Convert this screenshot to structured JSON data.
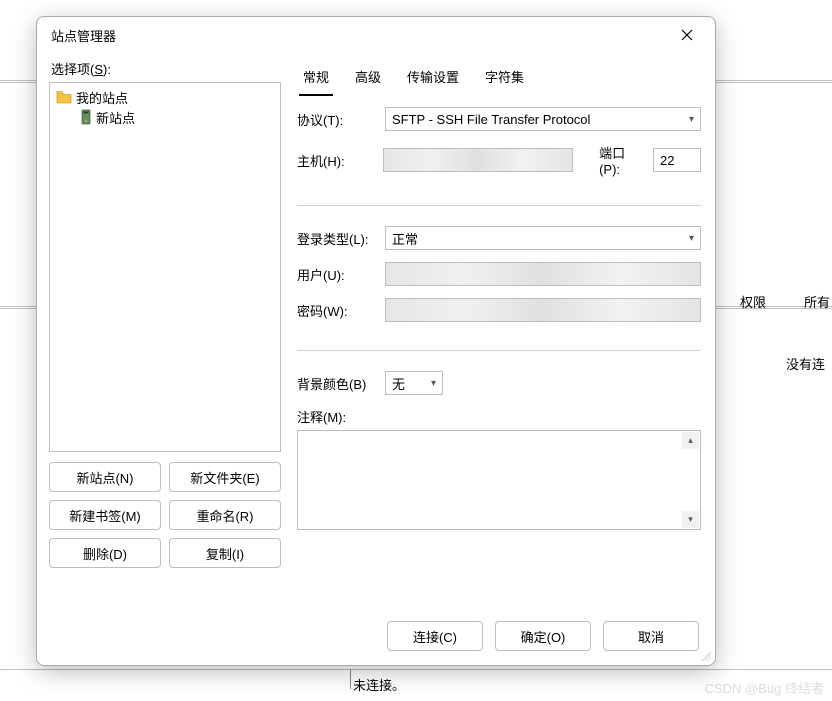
{
  "background": {
    "col_permissions": "权限",
    "col_owner_prefix": "所有",
    "no_connection_msg_prefix": "没有连",
    "status_text": "未连接。"
  },
  "dialog": {
    "title": "站点管理器",
    "select_label_pre": "选择项(",
    "select_label_key": "S",
    "select_label_post": "):",
    "tree": {
      "root": "我的站点",
      "child": "新站点"
    },
    "buttons": {
      "new_site": "新站点(N)",
      "new_folder": "新文件夹(E)",
      "new_bookmark": "新建书签(M)",
      "rename": "重命名(R)",
      "delete": "删除(D)",
      "copy": "复制(I)"
    },
    "tabs": {
      "general": "常规",
      "advanced": "高级",
      "transfer": "传输设置",
      "charset": "字符集"
    },
    "fields": {
      "protocol_label": "协议(T):",
      "protocol_value": "SFTP - SSH File Transfer Protocol",
      "host_label": "主机(H):",
      "host_value": "",
      "port_label": "端口(P):",
      "port_value": "22",
      "logon_type_label": "登录类型(L):",
      "logon_type_value": "正常",
      "user_label": "用户(U):",
      "user_value": "",
      "password_label": "密码(W):",
      "password_value": "",
      "bgcolor_label": "背景颜色(B)",
      "bgcolor_value": "无",
      "notes_label": "注释(M):",
      "notes_value": ""
    },
    "footer": {
      "connect": "连接(C)",
      "ok": "确定(O)",
      "cancel": "取消"
    }
  },
  "watermark": "CSDN @Bug 终结者"
}
